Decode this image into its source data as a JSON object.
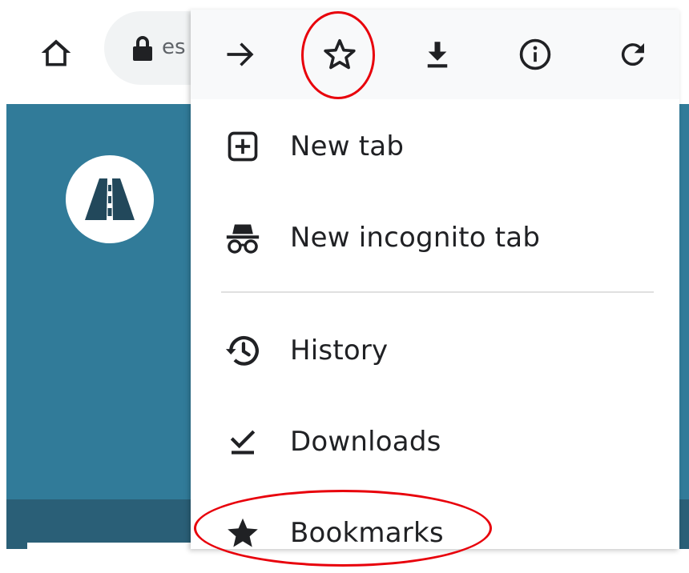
{
  "toolbar": {
    "url_text": "es",
    "home_icon": "home-icon",
    "lock_icon": "lock-icon"
  },
  "menu": {
    "icon_row": [
      {
        "name": "forward-icon"
      },
      {
        "name": "star-outline-icon"
      },
      {
        "name": "download-icon"
      },
      {
        "name": "info-icon"
      },
      {
        "name": "reload-icon"
      }
    ],
    "items": [
      {
        "label": "New tab",
        "icon": "new-tab-icon"
      },
      {
        "label": "New incognito tab",
        "icon": "incognito-icon"
      },
      {
        "label": "History",
        "icon": "history-icon"
      },
      {
        "label": "Downloads",
        "icon": "downloads-check-icon"
      },
      {
        "label": "Bookmarks",
        "icon": "star-filled-icon"
      }
    ]
  },
  "colors": {
    "page_background": "#317b99",
    "page_band": "#2a5f77",
    "annotation": "#e8000b",
    "icon": "#202124"
  }
}
